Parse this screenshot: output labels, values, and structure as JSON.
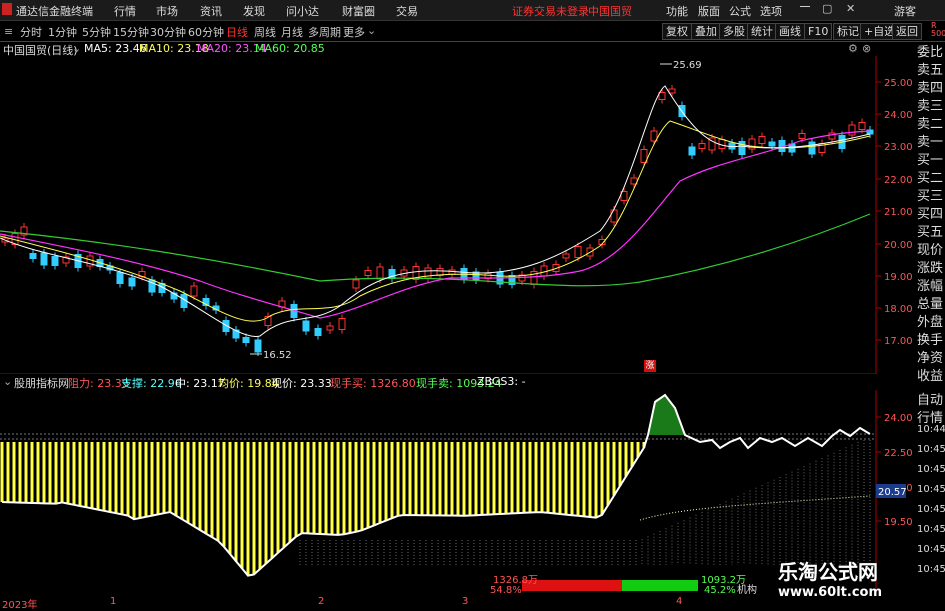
{
  "titlebar": {
    "app_name": "通达信金融终端",
    "menu": [
      "行情",
      "市场",
      "资讯",
      "发现",
      "问小达",
      "财富圈",
      "交易"
    ],
    "login_status": "证券交易未登录",
    "stock": "中国国贸",
    "right_menu": [
      "功能",
      "版面",
      "公式",
      "选项"
    ],
    "guest": "游客"
  },
  "toolbar": {
    "periods": [
      "分时",
      "1分钟",
      "5分钟",
      "15分钟",
      "30分钟",
      "60分钟",
      "日线",
      "周线",
      "月线",
      "多周期",
      "更多"
    ],
    "active_period": "日线",
    "right_buttons": [
      "复权",
      "叠加",
      "多股",
      "统计",
      "画线",
      "F10",
      "标记",
      "+自选",
      "返回"
    ]
  },
  "main_chart": {
    "stock_title": "中国国贸(日线)",
    "ma": [
      {
        "label": "MA5: 23.46",
        "color": "#ffffff"
      },
      {
        "label": "MA10: 23.18",
        "color": "#ffff55"
      },
      {
        "label": "MA20: 23.14",
        "color": "#ff55ff"
      },
      {
        "label": "MA60: 20.85",
        "color": "#55ff55"
      }
    ],
    "high_label": "25.69",
    "low_label": "16.52",
    "zhang": "涨",
    "y_ticks": [
      "25.00",
      "24.00",
      "23.00",
      "22.00",
      "21.00",
      "20.00",
      "19.00",
      "18.00",
      "17.00"
    ]
  },
  "indicator": {
    "name": "股朋指标网",
    "items": [
      {
        "label": "阻力: 23.39",
        "color": "#ff5555"
      },
      {
        "label": "支撑: 22.96",
        "color": "#55ffff"
      },
      {
        "label": "中: 23.17",
        "color": "#ffffff"
      },
      {
        "label": "均价: 19.84",
        "color": "#ffff55"
      },
      {
        "label": "现价: 23.33",
        "color": "#ffffff"
      },
      {
        "label": "现手买: 1326.80",
        "color": "#ff5555"
      },
      {
        "label": "现手卖: 1093.24",
        "color": "#55ff55"
      },
      {
        "label": "ZBGS3: -",
        "color": "#ffffff"
      }
    ],
    "y_ticks": [
      "24.00",
      "22.50",
      "21.00",
      "19.50"
    ],
    "current_value": "20.57",
    "buy_label": "1326.8万",
    "buy_pct": "54.8%",
    "sell_label": "1093.2万",
    "sell_pct": "45.2%",
    "inst_label": "机构"
  },
  "sidebar": {
    "top": "R 500",
    "items": [
      "委比",
      "卖五",
      "卖四",
      "卖三",
      "卖二",
      "卖一",
      "买一",
      "买二",
      "买三",
      "买四",
      "买五",
      "现价",
      "涨跌",
      "涨幅",
      "总量",
      "外盘",
      "换手",
      "净资",
      "收益",
      "自动",
      "行情"
    ],
    "times": [
      "10:44",
      "10:45",
      "10:45",
      "10:45",
      "10:45",
      "10:45",
      "10:45",
      "10:45"
    ]
  },
  "bottom": {
    "labels": [
      "2023年",
      "1",
      "2",
      "3",
      "4"
    ]
  },
  "watermark": {
    "title": "乐淘公式网",
    "url": "www.60lt.com"
  }
}
